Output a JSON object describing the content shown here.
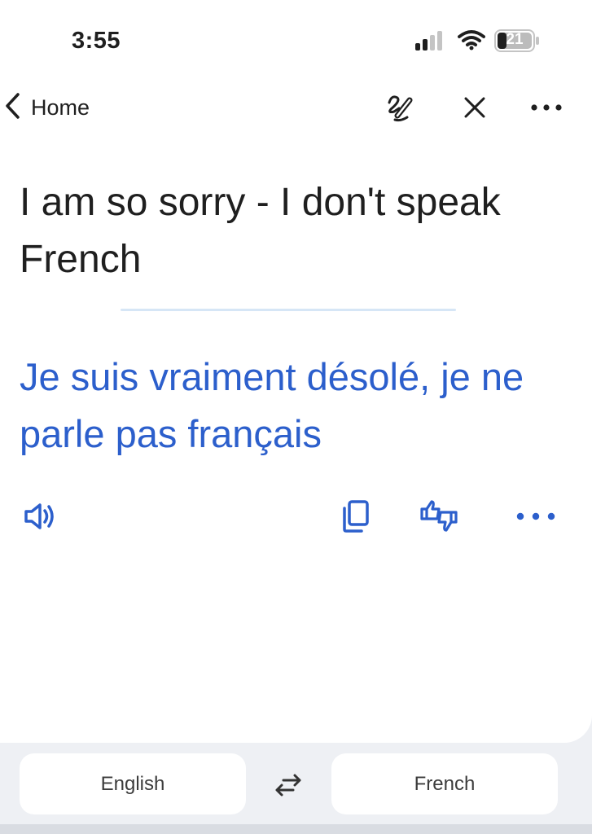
{
  "status_bar": {
    "time": "3:55",
    "battery_level": "21",
    "icons": [
      "cellular-signal-icon",
      "wifi-icon",
      "battery-icon"
    ]
  },
  "nav": {
    "back_label": "Home",
    "icons": [
      "back-chevron-icon",
      "handwriting-icon",
      "close-icon",
      "more-icon"
    ]
  },
  "translation": {
    "source_text": "I am so sorry - I don't speak French",
    "target_text": "Je suis vraiment désolé, je ne parle pas français"
  },
  "actions": {
    "icons": [
      "speaker-icon",
      "copy-icon",
      "feedback-icon",
      "more-icon"
    ]
  },
  "languages": {
    "source": "English",
    "target": "French",
    "swap_icon": "swap-icon"
  },
  "colors": {
    "accent": "#2c5fcc",
    "divider": "#d6e6f6",
    "background": "#eef0f4"
  }
}
